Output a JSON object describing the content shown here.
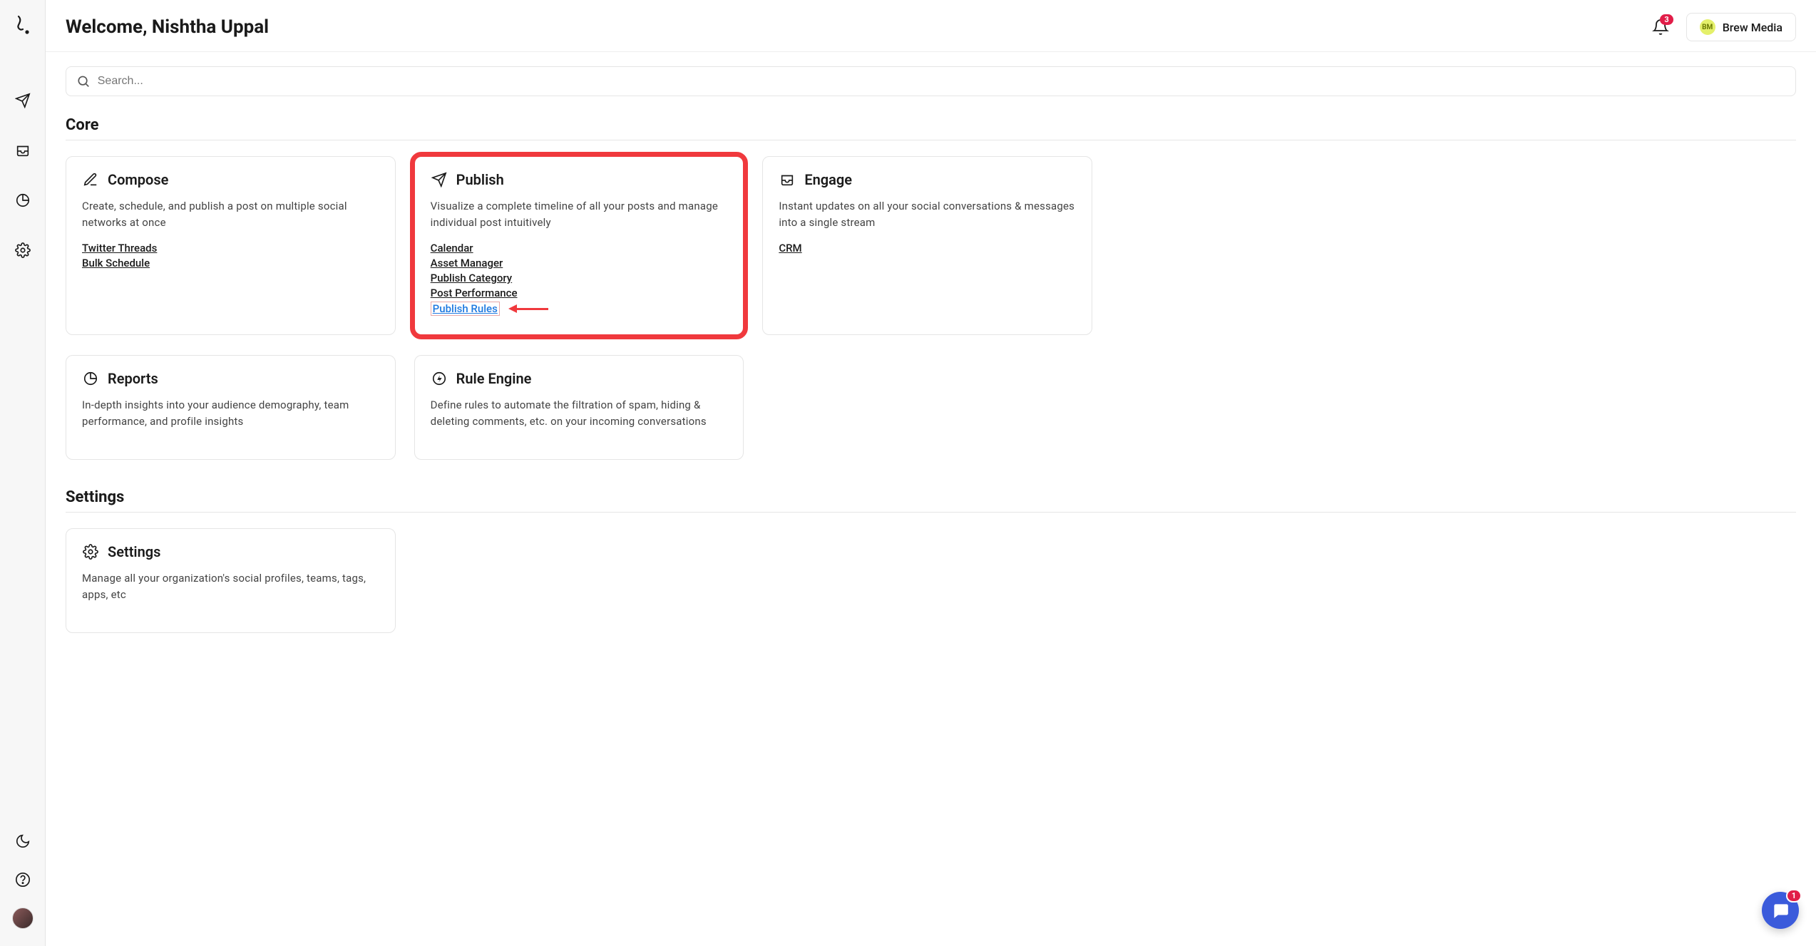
{
  "header": {
    "welcome": "Welcome, Nishtha Uppal",
    "notification_count": "3",
    "org_initials": "BM",
    "org_name": "Brew Media"
  },
  "search": {
    "placeholder": "Search..."
  },
  "sections": {
    "core_title": "Core",
    "settings_title": "Settings"
  },
  "cards": {
    "compose": {
      "title": "Compose",
      "desc": "Create, schedule, and publish a post on multiple social networks at once",
      "links": [
        "Twitter Threads",
        "Bulk Schedule"
      ]
    },
    "publish": {
      "title": "Publish",
      "desc": "Visualize a complete timeline of all your posts and manage individual post intuitively",
      "links": [
        "Calendar",
        "Asset Manager",
        "Publish Category",
        "Post Performance",
        "Publish Rules"
      ]
    },
    "engage": {
      "title": "Engage",
      "desc": "Instant updates on all your social conversations & messages into a single stream",
      "links": [
        "CRM"
      ]
    },
    "reports": {
      "title": "Reports",
      "desc": "In-depth insights into your audience demography, team performance, and profile insights"
    },
    "rule_engine": {
      "title": "Rule Engine",
      "desc": "Define rules to automate the filtration of spam, hiding & deleting comments, etc. on your incoming conversations"
    },
    "settings": {
      "title": "Settings",
      "desc": "Manage all your organization's social profiles, teams, tags, apps, etc"
    }
  },
  "intercom": {
    "count": "1"
  }
}
